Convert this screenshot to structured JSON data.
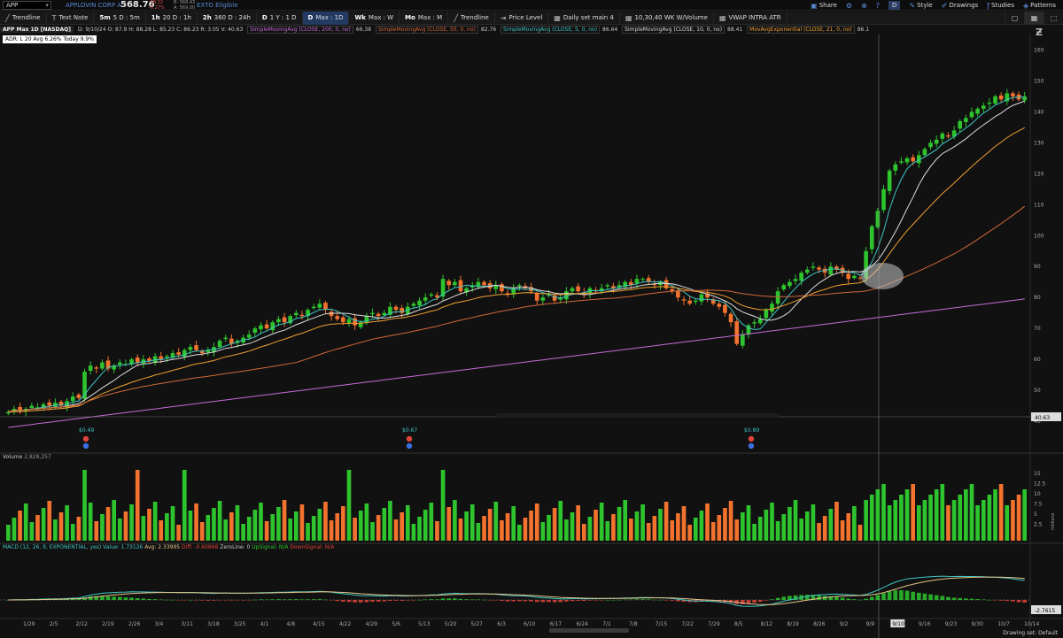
{
  "header": {
    "symbol": "APP",
    "company": "APPLOVIN CORP A",
    "price": "568.76",
    "change_lines": [
      "-39.22",
      "-6.27%"
    ],
    "bidask_lines": [
      "B: 568.43",
      "A: 569.00"
    ],
    "exto": "EXTO Eligible",
    "share": "Share",
    "style": "Style",
    "drawings": "Drawings",
    "studies": "Studies",
    "patterns": "Patterns",
    "d": "D"
  },
  "toolbar": {
    "items": [
      {
        "bold": "",
        "label": "Trendline",
        "icon": "trendline-icon"
      },
      {
        "bold": "",
        "label": "Text Note",
        "icon": "text-note-icon"
      },
      {
        "bold": "5m",
        "label": "5 D : 5m"
      },
      {
        "bold": "1h",
        "label": "20 D : 1h"
      },
      {
        "bold": "2h",
        "label": "360 D : 24h"
      },
      {
        "bold": "D",
        "label": "1 Y : 1 D"
      },
      {
        "bold": "D",
        "label": "Max : 1D",
        "active": true
      },
      {
        "bold": "Wk",
        "label": "Max : W"
      },
      {
        "bold": "Mo",
        "label": "Max : M"
      },
      {
        "bold": "",
        "label": "Trendline",
        "icon": "trendline-icon"
      },
      {
        "bold": "",
        "label": "Price Level",
        "icon": "price-level-icon"
      },
      {
        "bold": "",
        "label": "Daily set main 4",
        "icon": "grid-icon"
      },
      {
        "bold": "",
        "label": "10,30,40 WK W/Volume",
        "icon": "grid-icon"
      },
      {
        "bold": "",
        "label": "VWAP INTRA ATR",
        "icon": "grid-icon"
      }
    ]
  },
  "studies_bar": {
    "title": "APP Max 1D [NASDAQ]",
    "ohlc": "D: 9/10/24   O: 87.9   H: 88.28   L: 85.23   C: 86.23   R: 3.05   V: 40.63",
    "studies": [
      {
        "label": "SimpleMovingAvg (CLOSE, 200, 0, no)",
        "value": "66.38",
        "color": "#c56bd6"
      },
      {
        "label": "SimpleMovingAvg (CLOSE, 50, 0, no)",
        "value": "82.76",
        "color": "#d0683a"
      },
      {
        "label": "SimpleMovingAvg (CLOSE, 5, 0, no)",
        "value": "86.64",
        "color": "#3fc4c4"
      },
      {
        "label": "SimpleMovingAvg (CLOSE, 10, 0, no)",
        "value": "88.41",
        "color": "#dddddd"
      },
      {
        "label": "MovAvgExponential (CLOSE, 21, 0, no)",
        "value": "86.1",
        "color": "#f0a030"
      }
    ]
  },
  "adr": "ADR: L 20  Avg 6.26%  Today 9.9%",
  "chart_data": {
    "type": "candlestick",
    "title": "APP Max 1D [NASDAQ]",
    "y_range": [
      30,
      165
    ],
    "y_ticks": [
      40,
      50,
      60,
      70,
      80,
      90,
      100,
      110,
      120,
      130,
      140,
      150,
      160
    ],
    "x_labels": [
      "1/29",
      "2/5",
      "2/12",
      "2/19",
      "2/26",
      "3/4",
      "3/11",
      "3/18",
      "3/25",
      "4/1",
      "4/8",
      "4/15",
      "4/22",
      "4/29",
      "5/6",
      "5/13",
      "5/20",
      "5/27",
      "6/3",
      "6/10",
      "6/17",
      "6/24",
      "7/1",
      "7/8",
      "7/15",
      "7/22",
      "7/29",
      "8/5",
      "8/12",
      "8/19",
      "8/26",
      "9/2",
      "9/9",
      "9/10",
      "9/16",
      "9/23",
      "9/30",
      "10/7",
      "10/14"
    ],
    "crosshair_date": "9/10",
    "crosshair_price": "40.63",
    "closes": [
      43,
      44,
      43.5,
      44,
      45,
      44.5,
      45.5,
      45,
      46,
      45,
      46.5,
      48,
      47.5,
      56,
      58,
      57,
      59,
      57,
      58,
      59,
      58.5,
      60,
      59,
      60,
      59.5,
      61,
      60,
      61,
      62,
      61.5,
      63,
      64,
      63,
      62,
      63,
      64,
      66,
      67,
      65,
      66,
      67,
      68,
      70,
      71,
      70,
      72,
      73,
      72,
      74,
      75,
      74,
      76,
      77,
      78,
      76,
      74,
      73,
      72,
      73,
      71,
      72,
      74,
      75,
      74,
      75,
      77,
      76,
      75,
      77,
      78,
      79,
      80,
      81,
      80,
      86,
      84,
      85,
      82,
      83,
      84,
      85,
      84,
      83,
      84,
      82,
      81,
      83,
      84,
      83,
      82,
      79,
      80,
      81,
      79,
      80,
      82,
      83,
      82,
      81,
      83,
      82,
      83,
      84,
      83,
      84,
      85,
      84,
      86,
      86,
      85,
      84,
      85,
      83,
      82,
      80,
      79,
      78,
      79,
      81,
      80,
      78,
      77,
      75,
      72,
      65,
      68,
      71,
      72,
      73,
      76,
      78,
      82,
      84,
      85,
      86,
      88,
      89,
      90,
      89,
      88,
      90,
      89,
      88,
      86,
      87,
      86.2,
      95,
      103,
      108,
      115,
      121,
      123,
      124,
      125,
      124,
      126,
      128,
      130,
      131,
      133,
      132,
      134,
      137,
      138,
      140,
      141,
      142,
      143,
      145,
      144,
      146,
      145,
      144,
      145
    ],
    "dividends": [
      {
        "label": "$0.49"
      },
      {
        "label": "$0.67"
      },
      {
        "label": "$0.89"
      }
    ],
    "volume": {
      "label": "Volume",
      "value": "2,828,257",
      "y_ticks": [
        "15",
        "12.5",
        "10",
        "7.5",
        "5",
        "2.5"
      ],
      "unit": "millions"
    },
    "macd": {
      "label": "MACD (12, 26, 9, EXPONENTIAL, yes)",
      "value": "Value: 1.73126",
      "avg": "Avg: 2.33995",
      "diff": "Diff: -0.60868",
      "zero": "ZeroLine: 0",
      "up": "UpSignal: N/A",
      "down": "DownSignal: N/A",
      "readout": "-2.7615"
    }
  },
  "footer": {
    "drawing_set": "Drawing set: Default"
  },
  "colors": {
    "up": "#2ec42e",
    "down": "#f2722e",
    "bg": "#111111"
  }
}
